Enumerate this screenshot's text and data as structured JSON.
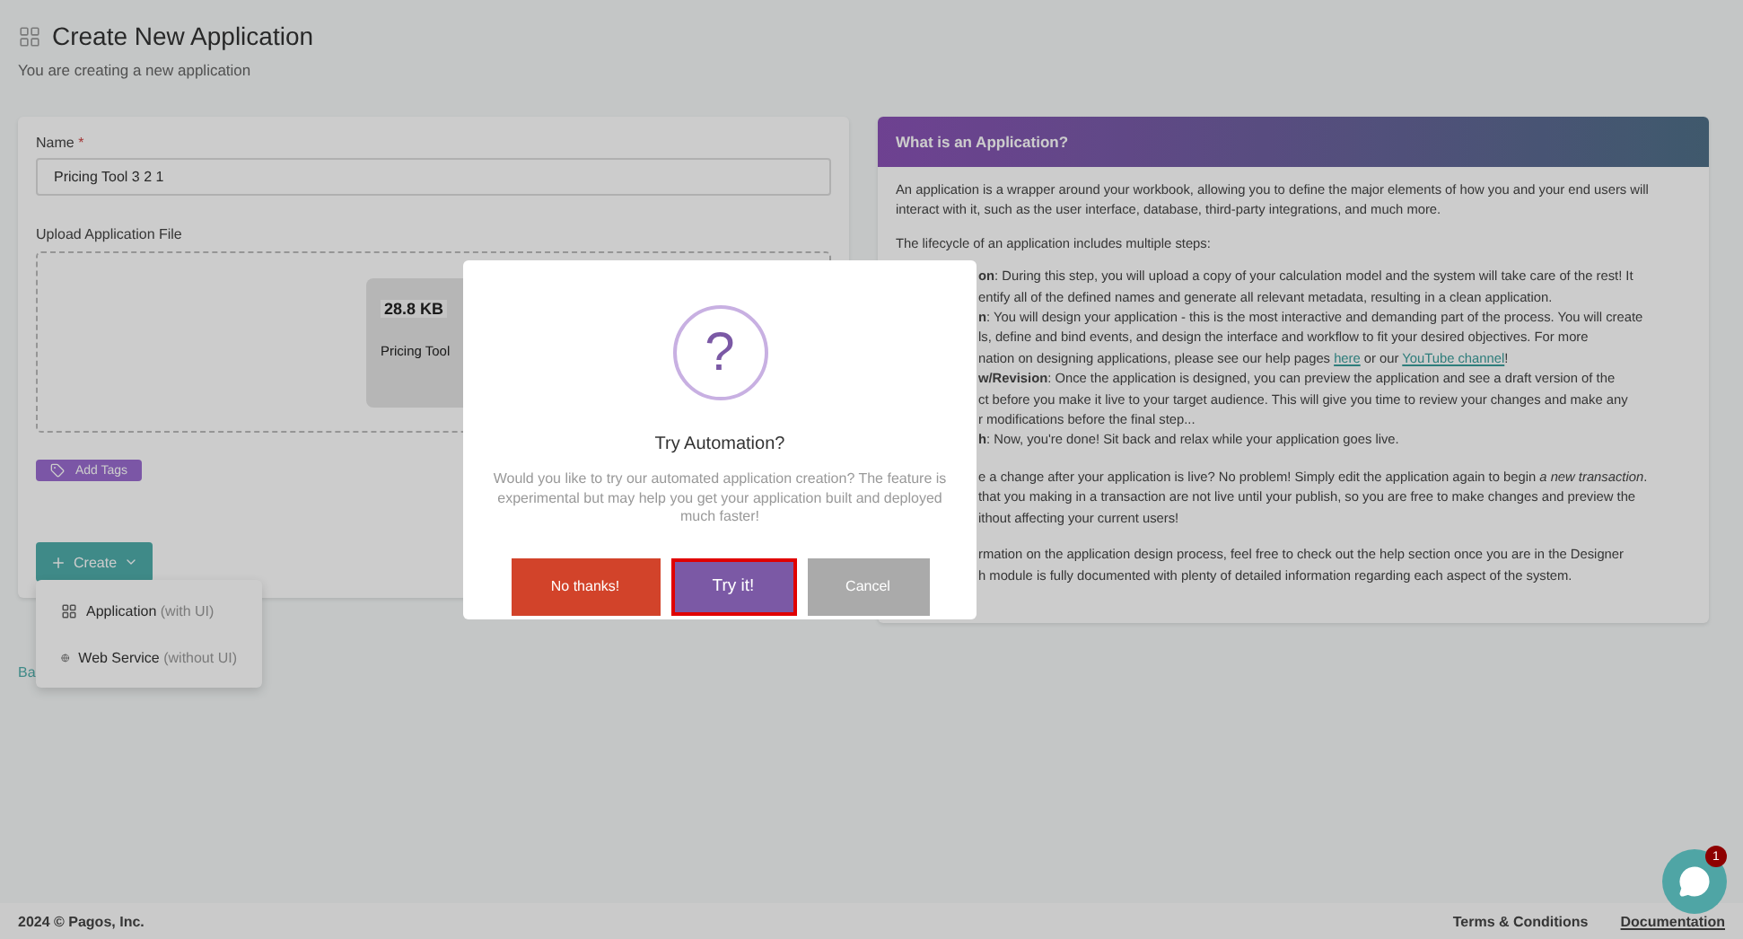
{
  "page": {
    "title": "Create New Application",
    "subtitle": "You are creating a new application"
  },
  "form": {
    "name_label": "Name",
    "required_mark": "*",
    "name_value": "Pricing Tool 3 2 1",
    "upload_label": "Upload Application File",
    "file_size": "28.8 KB",
    "file_name": "Pricing Tool",
    "tags_button": "Add Tags",
    "create_button": "Create",
    "back_link": "Ba",
    "create_menu": [
      {
        "label": "Application",
        "hint": "(with UI)",
        "kind": "grid"
      },
      {
        "label": "Web Service",
        "hint": "(without UI)",
        "kind": "globe"
      }
    ]
  },
  "info": {
    "title": "What is an Application?",
    "intro": "An application is a wrapper around your workbook, allowing you to define the major elements of how you and your end users will interact with it, such as the user interface, database, third-party integrations, and much more.",
    "lifecycle": "The lifecycle of an application includes multiple steps:",
    "blocks": [
      [
        [
          {
            "kind": "text",
            "text": "**on**: During this step, you will upload a copy of your calculation model and the system will take care of the rest! It"
          }
        ],
        [
          {
            "kind": "text",
            "text": "entify all of the defined names and generate all relevant metadata, resulting in a clean application."
          }
        ],
        [
          {
            "kind": "text",
            "text": "**n**: You will design your application - this is the most interactive and demanding part of the process. You will create"
          }
        ],
        [
          {
            "kind": "text",
            "text": "ls, define and bind events, and design the interface and workflow to fit your desired objectives. For more"
          }
        ],
        [
          {
            "kind": "text",
            "text": "nation on designing applications, please see our help pages "
          },
          {
            "kind": "link",
            "text": "here"
          },
          {
            "kind": "text",
            "text": " or our "
          },
          {
            "kind": "link",
            "text": "YouTube channel"
          },
          {
            "kind": "text",
            "text": "!"
          }
        ],
        [
          {
            "kind": "text",
            "text": "**w/Revision**: Once the application is designed, you can preview the application and see a draft version of the"
          }
        ],
        [
          {
            "kind": "text",
            "text": "ct before you make it live to your target audience. This will give you time to review your changes and make any"
          }
        ],
        [
          {
            "kind": "text",
            "text": "r modifications before the final step..."
          }
        ],
        [
          {
            "kind": "text",
            "text": "**h**: Now, you're done! Sit back and relax while your application goes live."
          }
        ]
      ],
      [
        [
          {
            "kind": "text",
            "text": "e a change after your application is live? No problem! Simply edit the application again to begin *a new transaction*."
          }
        ],
        [
          {
            "kind": "text",
            "text": "that you making in a transaction are not live until your publish, so you are free to make changes and preview the"
          }
        ],
        [
          {
            "kind": "text",
            "text": "ithout affecting your current users!"
          }
        ]
      ],
      [
        [
          {
            "kind": "text",
            "text": "rmation on the application design process, feel free to check out the help section once you are in the Designer"
          }
        ],
        [
          {
            "kind": "text",
            "text": "h module is fully documented with plenty of detailed information regarding each aspect of the system."
          }
        ]
      ]
    ]
  },
  "modal": {
    "icon_glyph": "?",
    "title": "Try Automation?",
    "message": "Would you like to try our automated application creation? The feature is experimental but may help you get your application built and deployed much faster!",
    "buttons": [
      {
        "label": "No thanks!",
        "kind": "decline",
        "highlighted": false
      },
      {
        "label": "Try it!",
        "kind": "accept",
        "highlighted": true
      },
      {
        "label": "Cancel",
        "kind": "cancel",
        "highlighted": false
      }
    ]
  },
  "footer": {
    "copyright": "2024 © Pagos, Inc.",
    "links": [
      "Terms & Conditions",
      "Documentation"
    ]
  },
  "chat": {
    "badge": "1"
  }
}
